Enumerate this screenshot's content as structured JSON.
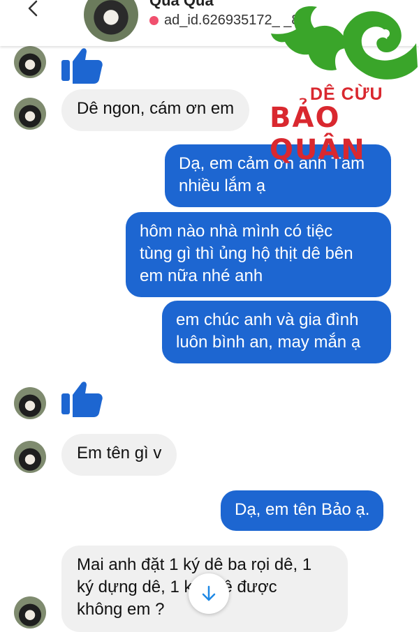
{
  "header": {
    "contact_name": "Qua Qua",
    "ad_id": "ad_id.626935172_ _84"
  },
  "logo": {
    "line1": "DÊ CỪU",
    "line2": "BẢO QUÂN",
    "green": "#3aa52a",
    "red": "#d9282f"
  },
  "colors": {
    "outgoing_bubble": "#1d66d1",
    "incoming_bubble": "#f0f0f0",
    "like_blue": "#1d66d1"
  },
  "messages": [
    {
      "from": "contact",
      "type": "like"
    },
    {
      "from": "contact",
      "type": "text",
      "text": "Dê ngon, cám ơn em"
    },
    {
      "from": "me",
      "type": "text",
      "lines": [
        "Dạ, em cảm ơn anh Tâm",
        "nhiều lắm ạ"
      ]
    },
    {
      "from": "me",
      "type": "text",
      "lines": [
        "hôm nào nhà mình có tiệc",
        "tùng gì thì ủng hộ thịt dê bên",
        "em nữa nhé anh"
      ]
    },
    {
      "from": "me",
      "type": "text",
      "lines": [
        "em chúc anh và gia đình",
        "luôn bình an, may mắn ạ"
      ]
    },
    {
      "from": "contact",
      "type": "like"
    },
    {
      "from": "contact",
      "type": "text",
      "text": "Em tên gì v"
    },
    {
      "from": "me",
      "type": "text",
      "text": "Dạ, em tên Bảo ạ."
    },
    {
      "from": "contact",
      "type": "text",
      "lines": [
        "Mai anh đặt 1 ký dê ba rọi dê, 1",
        "ký dựng dê, 1 ký   i dê được",
        "không em ?"
      ]
    }
  ],
  "icons": {
    "back": "chevron-left-icon",
    "like": "thumbs-up-icon",
    "scroll": "arrow-down-icon"
  }
}
